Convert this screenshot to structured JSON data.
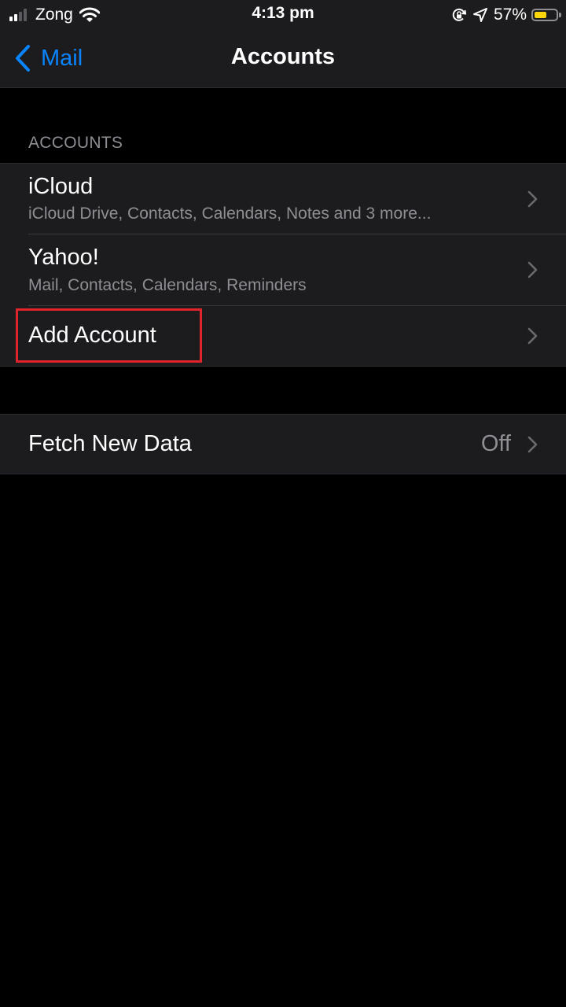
{
  "status_bar": {
    "carrier": "Zong",
    "time": "4:13 pm",
    "battery_percent": "57%",
    "battery_level": 0.57,
    "signal_bars_active": 2,
    "icons": [
      "signal-icon",
      "wifi-icon",
      "rotation-lock-icon",
      "location-icon",
      "battery-icon"
    ]
  },
  "nav": {
    "back_label": "Mail",
    "title": "Accounts"
  },
  "accounts_section": {
    "header": "ACCOUNTS",
    "items": [
      {
        "title": "iCloud",
        "subtitle": "iCloud Drive, Contacts, Calendars, Notes and 3 more..."
      },
      {
        "title": "Yahoo!",
        "subtitle": "Mail, Contacts, Calendars, Reminders"
      },
      {
        "title": "Add Account",
        "highlighted": true
      }
    ]
  },
  "fetch_section": {
    "title": "Fetch New Data",
    "value": "Off"
  },
  "colors": {
    "background": "#000000",
    "cell": "#1c1c1e",
    "accent": "#0a84ff",
    "secondary_text": "#8e8e93",
    "highlight": "#e0242b",
    "battery": "#ffd60a"
  }
}
